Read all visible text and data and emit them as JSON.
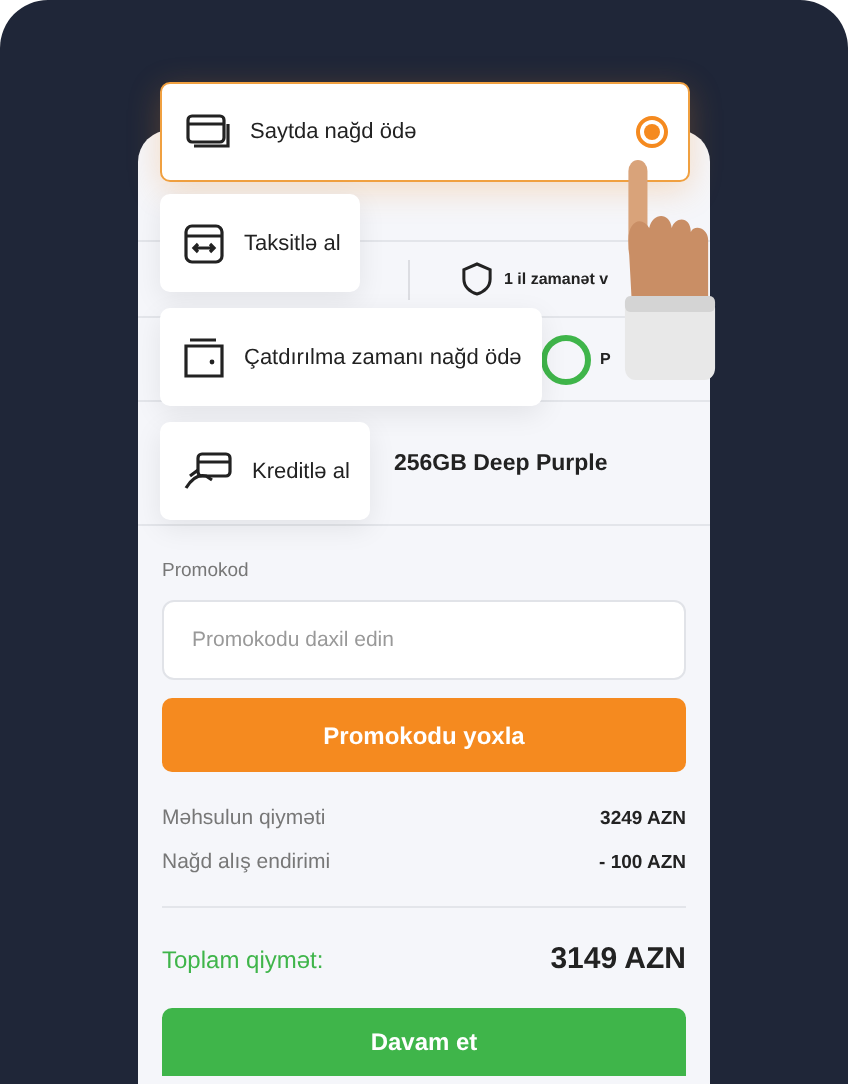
{
  "payment_options": [
    {
      "kind": "card",
      "label": "Saytda nağd ödə",
      "selected": true
    },
    {
      "kind": "installment",
      "label": "Taksitlə al",
      "selected": false
    },
    {
      "kind": "wallet",
      "label": "Çatdırılma zamanı nağd ödə",
      "selected": false
    },
    {
      "kind": "credit",
      "label": "Kreditlə al",
      "selected": false
    }
  ],
  "product_info": {
    "warranty": "1 il zamanət v",
    "status": "P",
    "product": "256GB Deep Purple"
  },
  "promo": {
    "label": "Promokod",
    "placeholder": "Promokodu daxil edin",
    "button": "Promokodu yoxla"
  },
  "summary": [
    {
      "label": "Məhsulun qiyməti",
      "value": "3249 AZN"
    },
    {
      "label": "Nağd alış endirimi",
      "value": "- 100 AZN"
    }
  ],
  "total": {
    "label": "Toplam qiymət:",
    "value": "3149 AZN"
  },
  "continue_button": "Davam et"
}
